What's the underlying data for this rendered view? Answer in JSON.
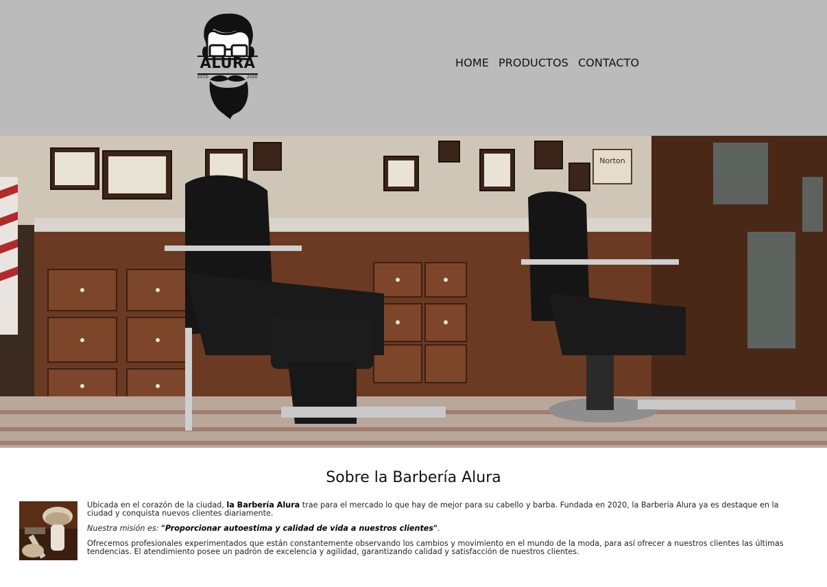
{
  "header": {
    "logo": {
      "brand": "ALURA",
      "estd_left": "ESTD",
      "estd_right": "2020",
      "icon": "bearded-man-glasses-logo-icon"
    },
    "nav": [
      {
        "label": "HOME"
      },
      {
        "label": "PRODUCTOS"
      },
      {
        "label": "CONTACTO"
      }
    ]
  },
  "banner": {
    "description_icon": "barbershop-interior-photo",
    "sign_text": "Norton"
  },
  "about": {
    "title": "Sobre la Barbería Alura",
    "image_icon": "shaving-brush-razor-photo",
    "p1_before": "Ubicada en el corazón de la ciudad, ",
    "p1_strong": "la Barbería Alura",
    "p1_after": " trae para el mercado lo que hay de mejor para su cabello y barba. Fundada en 2020, la Barbería Alura ya es destaque en la ciudad y conquista nuevos clientes diariamente.",
    "mission_label": "Nuestra misión es: ",
    "mission_quote": "\"Proporcionar autoestima y calidad de vida a nuestros clientes\"",
    "mission_end": ".",
    "p3": "Ofrecemos profesionales experimentados que están constantemente observando los cambios y movimiento en el mundo de la moda, para así ofrecer a nuestros clientes las últimas tendencias. El atendimiento posee un padrón de excelencia y agilidad, garantizando calidad y satisfacción de nuestros clientes."
  },
  "colors": {
    "header_bg": "#bbbbbb",
    "page_bg": "#ffffff",
    "text": "#222222"
  }
}
